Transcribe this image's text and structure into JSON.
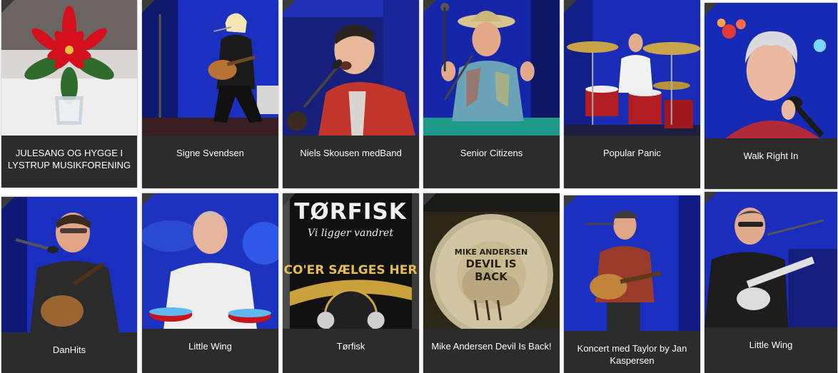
{
  "cards": [
    {
      "title": "JULESANG OG HYGGE I LYSTRUP MUSIKFORENING",
      "image": "poinsettia-christmas-photo"
    },
    {
      "title": "Signe Svendsen",
      "image": "guitarist-singer-photo"
    },
    {
      "title": "Niels Skousen medBand",
      "image": "singer-microphone-photo"
    },
    {
      "title": "Senior Citizens",
      "image": "singer-straw-hat-photo"
    },
    {
      "title": "Popular Panic",
      "image": "drummer-photo"
    },
    {
      "title": "Walk Right In",
      "image": "female-singer-photo"
    },
    {
      "title": "DanHits",
      "image": "guitarist-singer-photo"
    },
    {
      "title": "Little Wing",
      "image": "drummer-photo"
    },
    {
      "title": "Tørfisk",
      "image": "torfisk-poster"
    },
    {
      "title": "Mike Andersen Devil Is Back!",
      "image": "bass-drum-photo"
    },
    {
      "title": "Koncert med Taylor by Jan Kaspersen",
      "image": "acoustic-guitarist-photo"
    },
    {
      "title": "Little Wing",
      "image": "guitarist-leather-jacket-photo"
    }
  ],
  "poster": {
    "brand": "TØRFISK",
    "slogan": "Vi ligger vandret",
    "tagline": "CO'ER SÆLGES HER"
  },
  "drumhead": {
    "line1": "MIKE ANDERSEN",
    "line2": "DEVIL IS",
    "line3": "BACK"
  },
  "colors": {
    "card_background": "#2c2c2c",
    "stage_blue": "#1d2fb5",
    "title_text": "#ffffff"
  }
}
